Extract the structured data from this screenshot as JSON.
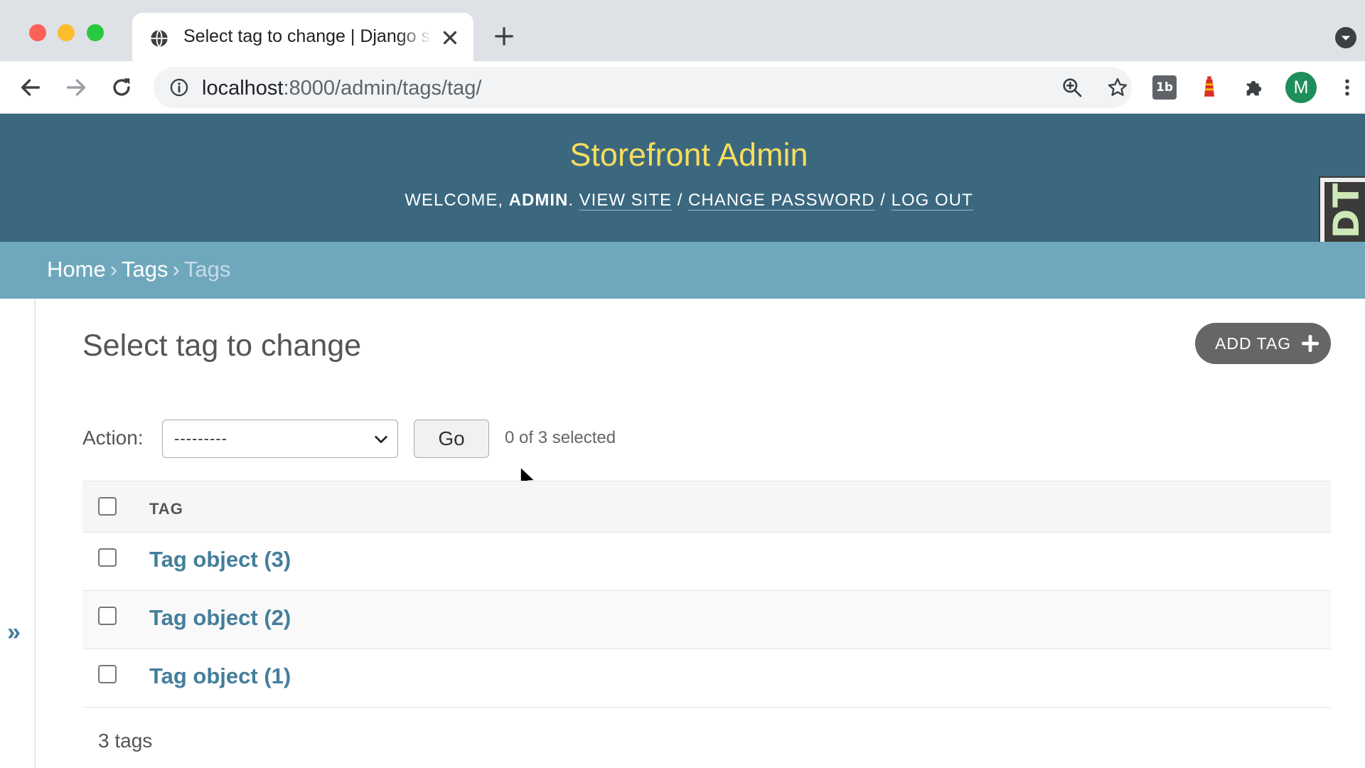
{
  "browser": {
    "tab_title": "Select tag to change | Django site admin",
    "url_host": "localhost",
    "url_path": ":8000/admin/tags/tag/",
    "avatar_letter": "M",
    "extension_label": "1b"
  },
  "header": {
    "site_title": "Storefront Admin",
    "welcome": "Welcome,",
    "username": "admin",
    "view_site": "View site",
    "change_password": "Change password",
    "log_out": "Log out"
  },
  "djdt_label": "DjDT",
  "breadcrumbs": {
    "home": "Home",
    "app": "Tags",
    "model": "Tags"
  },
  "sidebar": {
    "toggle": "»"
  },
  "content": {
    "title": "Select tag to change",
    "add_button": "ADD TAG",
    "action_label": "Action:",
    "action_selected": "---------",
    "go_button": "Go",
    "selected_count": "0 of 3 selected",
    "column_header": "TAG",
    "rows": [
      {
        "label": "Tag object (3)"
      },
      {
        "label": "Tag object (2)"
      },
      {
        "label": "Tag object (1)"
      }
    ],
    "paginator": "3 tags"
  },
  "colors": {
    "header_bg": "#3b687f",
    "breadcrumbs_bg": "#6fa8bd",
    "site_title": "#f5dd5d",
    "link": "#447e9b"
  }
}
